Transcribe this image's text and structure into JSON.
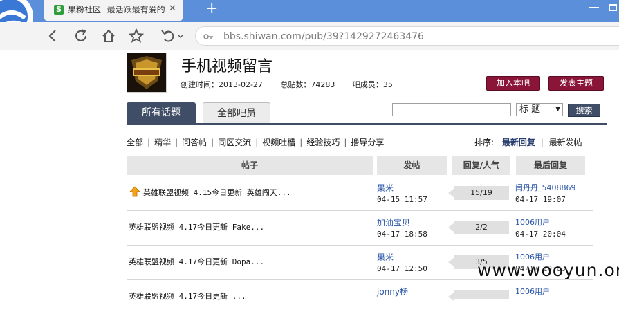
{
  "browser": {
    "tab_title": "果粉社区--最活跃最有爱的",
    "tab_favicon_letter": "S",
    "url": "bbs.shiwan.com/pub/39?1429272463476"
  },
  "group": {
    "title": "手机视频留言",
    "created_label": "创建时间：2013-02-27",
    "posts_label": "总贴数：74283",
    "members_label": "吧成员：35",
    "join_button": "加入本吧",
    "post_button": "发表主题"
  },
  "tabs": {
    "all": "所有话题",
    "members": "全部吧员"
  },
  "search": {
    "select_value": "标 题",
    "button": "搜索",
    "input_value": ""
  },
  "filters": [
    "全部",
    "精华",
    "问答帖",
    "同区交流",
    "视频吐槽",
    "经验技巧",
    "撸导分享"
  ],
  "sort": {
    "label": "排序:",
    "options": [
      "最新回复",
      "最新发帖"
    ]
  },
  "table": {
    "headers": [
      "帖子",
      "发帖",
      "回复/人气",
      "最后回复"
    ],
    "rows": [
      {
        "title": "英雄联盟视频 4.15今日更新 英雄闯天...",
        "author": "果米",
        "time": "04-15 11:57",
        "counts": "15/19",
        "last_user": "闫丹丹_5408869",
        "last_time": "04-17 19:07",
        "pinned": true
      },
      {
        "title": "英雄联盟视频 4.17今日更新 Fake...",
        "author": "加油宝贝",
        "time": "04-17 18:58",
        "counts": "2/2",
        "last_user": "1006用户",
        "last_time": "04-17 20:04",
        "pinned": false
      },
      {
        "title": "英雄联盟视频 4.17今日更新 Dopa...",
        "author": "果米",
        "time": "04-17 12:50",
        "counts": "3/5",
        "last_user": "1006用户",
        "last_time": "04-17 20:03",
        "pinned": false
      },
      {
        "title": "英雄联盟视频 4.17今日更新 ...",
        "author": "jonny杨",
        "time": "",
        "counts": "",
        "last_user": "1006用户",
        "last_time": "",
        "pinned": false
      }
    ]
  },
  "watermark": "www.wooyun.org"
}
